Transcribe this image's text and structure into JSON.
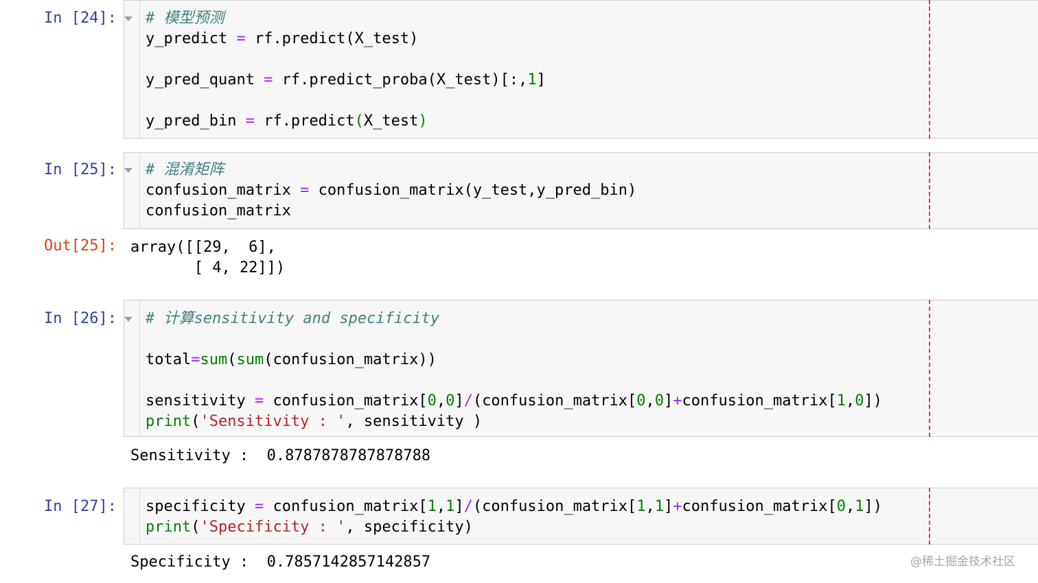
{
  "cells": [
    {
      "prompt": "In [24]:",
      "lines": [
        [
          {
            "t": "# 模型预测",
            "c": "cm"
          }
        ],
        [
          {
            "t": "y_predict "
          },
          {
            "t": "=",
            "c": "op"
          },
          {
            "t": " rf.predict(X_test)"
          }
        ],
        [
          {
            "t": ""
          }
        ],
        [
          {
            "t": "y_pred_quant "
          },
          {
            "t": "=",
            "c": "op"
          },
          {
            "t": " rf.predict_proba(X_test)[:,"
          },
          {
            "t": "1",
            "c": "num"
          },
          {
            "t": "]"
          }
        ],
        [
          {
            "t": ""
          }
        ],
        [
          {
            "t": "y_pred_bin "
          },
          {
            "t": "=",
            "c": "op"
          },
          {
            "t": " rf.predict"
          },
          {
            "t": "(",
            "c": "kw"
          },
          {
            "t": "X_test"
          },
          {
            "t": ")",
            "c": "kw"
          }
        ]
      ]
    },
    {
      "prompt": "In [25]:",
      "lines": [
        [
          {
            "t": "# 混淆矩阵",
            "c": "cm"
          }
        ],
        [
          {
            "t": "confusion_matrix "
          },
          {
            "t": "=",
            "c": "op"
          },
          {
            "t": " confusion_matrix(y_test,y_pred_bin)"
          }
        ],
        [
          {
            "t": "confusion_matrix"
          }
        ]
      ],
      "output_prompt": "Out[25]:",
      "output": "array([[29,  6],\n       [ 4, 22]])"
    },
    {
      "prompt": "In [26]:",
      "lines": [
        [
          {
            "t": "# 计算sensitivity and specificity",
            "c": "cm"
          }
        ],
        [
          {
            "t": ""
          }
        ],
        [
          {
            "t": "total"
          },
          {
            "t": "=",
            "c": "op"
          },
          {
            "t": "sum",
            "c": "kw"
          },
          {
            "t": "("
          },
          {
            "t": "sum",
            "c": "kw"
          },
          {
            "t": "(confusion_matrix))"
          }
        ],
        [
          {
            "t": ""
          }
        ],
        [
          {
            "t": "sensitivity "
          },
          {
            "t": "=",
            "c": "op"
          },
          {
            "t": " confusion_matrix["
          },
          {
            "t": "0",
            "c": "num"
          },
          {
            "t": ","
          },
          {
            "t": "0",
            "c": "num"
          },
          {
            "t": "]"
          },
          {
            "t": "/",
            "c": "op"
          },
          {
            "t": "(confusion_matrix["
          },
          {
            "t": "0",
            "c": "num"
          },
          {
            "t": ","
          },
          {
            "t": "0",
            "c": "num"
          },
          {
            "t": "]"
          },
          {
            "t": "+",
            "c": "op"
          },
          {
            "t": "confusion_matrix["
          },
          {
            "t": "1",
            "c": "num"
          },
          {
            "t": ","
          },
          {
            "t": "0",
            "c": "num"
          },
          {
            "t": "])"
          }
        ],
        [
          {
            "t": "print",
            "c": "kw"
          },
          {
            "t": "("
          },
          {
            "t": "'Sensitivity : '",
            "c": "str"
          },
          {
            "t": ", sensitivity )"
          }
        ]
      ],
      "output": "Sensitivity :  0.8787878787878788"
    },
    {
      "prompt": "In [27]:",
      "lines": [
        [
          {
            "t": "specificity "
          },
          {
            "t": "=",
            "c": "op"
          },
          {
            "t": " confusion_matrix["
          },
          {
            "t": "1",
            "c": "num"
          },
          {
            "t": ","
          },
          {
            "t": "1",
            "c": "num"
          },
          {
            "t": "]"
          },
          {
            "t": "/",
            "c": "op"
          },
          {
            "t": "(confusion_matrix["
          },
          {
            "t": "1",
            "c": "num"
          },
          {
            "t": ","
          },
          {
            "t": "1",
            "c": "num"
          },
          {
            "t": "]"
          },
          {
            "t": "+",
            "c": "op"
          },
          {
            "t": "confusion_matrix["
          },
          {
            "t": "0",
            "c": "num"
          },
          {
            "t": ","
          },
          {
            "t": "1",
            "c": "num"
          },
          {
            "t": "])"
          }
        ],
        [
          {
            "t": "print",
            "c": "kw"
          },
          {
            "t": "("
          },
          {
            "t": "'Specificity : '",
            "c": "str"
          },
          {
            "t": ", specificity)"
          }
        ]
      ],
      "output": "Specificity :  0.7857142857142857"
    }
  ],
  "watermark": "@稀土掘金技术社区",
  "colors": {
    "prompt_in": "#303F9F",
    "prompt_out": "#D84315",
    "comment": "#408080",
    "operator": "#AA22FF",
    "builtin": "#008000",
    "string": "#BA2121",
    "ruler": "#e53935"
  }
}
